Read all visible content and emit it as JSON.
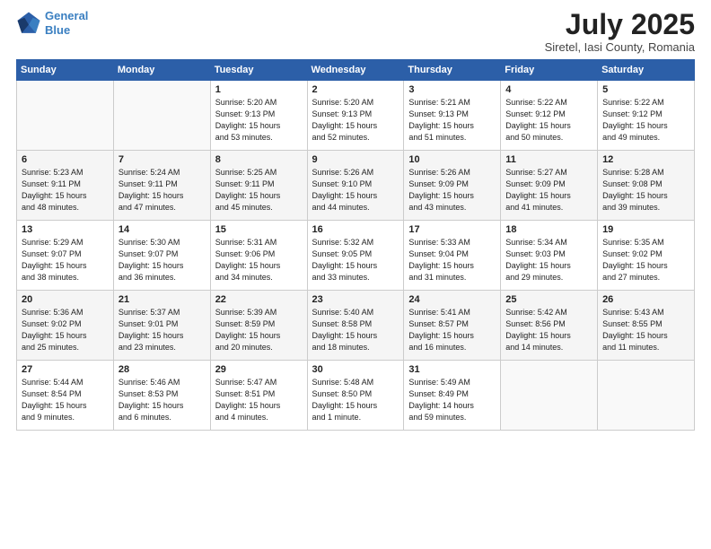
{
  "header": {
    "logo_line1": "General",
    "logo_line2": "Blue",
    "month": "July 2025",
    "location": "Siretel, Iasi County, Romania"
  },
  "weekdays": [
    "Sunday",
    "Monday",
    "Tuesday",
    "Wednesday",
    "Thursday",
    "Friday",
    "Saturday"
  ],
  "weeks": [
    [
      {
        "day": "",
        "info": ""
      },
      {
        "day": "",
        "info": ""
      },
      {
        "day": "1",
        "info": "Sunrise: 5:20 AM\nSunset: 9:13 PM\nDaylight: 15 hours\nand 53 minutes."
      },
      {
        "day": "2",
        "info": "Sunrise: 5:20 AM\nSunset: 9:13 PM\nDaylight: 15 hours\nand 52 minutes."
      },
      {
        "day": "3",
        "info": "Sunrise: 5:21 AM\nSunset: 9:13 PM\nDaylight: 15 hours\nand 51 minutes."
      },
      {
        "day": "4",
        "info": "Sunrise: 5:22 AM\nSunset: 9:12 PM\nDaylight: 15 hours\nand 50 minutes."
      },
      {
        "day": "5",
        "info": "Sunrise: 5:22 AM\nSunset: 9:12 PM\nDaylight: 15 hours\nand 49 minutes."
      }
    ],
    [
      {
        "day": "6",
        "info": "Sunrise: 5:23 AM\nSunset: 9:11 PM\nDaylight: 15 hours\nand 48 minutes."
      },
      {
        "day": "7",
        "info": "Sunrise: 5:24 AM\nSunset: 9:11 PM\nDaylight: 15 hours\nand 47 minutes."
      },
      {
        "day": "8",
        "info": "Sunrise: 5:25 AM\nSunset: 9:11 PM\nDaylight: 15 hours\nand 45 minutes."
      },
      {
        "day": "9",
        "info": "Sunrise: 5:26 AM\nSunset: 9:10 PM\nDaylight: 15 hours\nand 44 minutes."
      },
      {
        "day": "10",
        "info": "Sunrise: 5:26 AM\nSunset: 9:09 PM\nDaylight: 15 hours\nand 43 minutes."
      },
      {
        "day": "11",
        "info": "Sunrise: 5:27 AM\nSunset: 9:09 PM\nDaylight: 15 hours\nand 41 minutes."
      },
      {
        "day": "12",
        "info": "Sunrise: 5:28 AM\nSunset: 9:08 PM\nDaylight: 15 hours\nand 39 minutes."
      }
    ],
    [
      {
        "day": "13",
        "info": "Sunrise: 5:29 AM\nSunset: 9:07 PM\nDaylight: 15 hours\nand 38 minutes."
      },
      {
        "day": "14",
        "info": "Sunrise: 5:30 AM\nSunset: 9:07 PM\nDaylight: 15 hours\nand 36 minutes."
      },
      {
        "day": "15",
        "info": "Sunrise: 5:31 AM\nSunset: 9:06 PM\nDaylight: 15 hours\nand 34 minutes."
      },
      {
        "day": "16",
        "info": "Sunrise: 5:32 AM\nSunset: 9:05 PM\nDaylight: 15 hours\nand 33 minutes."
      },
      {
        "day": "17",
        "info": "Sunrise: 5:33 AM\nSunset: 9:04 PM\nDaylight: 15 hours\nand 31 minutes."
      },
      {
        "day": "18",
        "info": "Sunrise: 5:34 AM\nSunset: 9:03 PM\nDaylight: 15 hours\nand 29 minutes."
      },
      {
        "day": "19",
        "info": "Sunrise: 5:35 AM\nSunset: 9:02 PM\nDaylight: 15 hours\nand 27 minutes."
      }
    ],
    [
      {
        "day": "20",
        "info": "Sunrise: 5:36 AM\nSunset: 9:02 PM\nDaylight: 15 hours\nand 25 minutes."
      },
      {
        "day": "21",
        "info": "Sunrise: 5:37 AM\nSunset: 9:01 PM\nDaylight: 15 hours\nand 23 minutes."
      },
      {
        "day": "22",
        "info": "Sunrise: 5:39 AM\nSunset: 8:59 PM\nDaylight: 15 hours\nand 20 minutes."
      },
      {
        "day": "23",
        "info": "Sunrise: 5:40 AM\nSunset: 8:58 PM\nDaylight: 15 hours\nand 18 minutes."
      },
      {
        "day": "24",
        "info": "Sunrise: 5:41 AM\nSunset: 8:57 PM\nDaylight: 15 hours\nand 16 minutes."
      },
      {
        "day": "25",
        "info": "Sunrise: 5:42 AM\nSunset: 8:56 PM\nDaylight: 15 hours\nand 14 minutes."
      },
      {
        "day": "26",
        "info": "Sunrise: 5:43 AM\nSunset: 8:55 PM\nDaylight: 15 hours\nand 11 minutes."
      }
    ],
    [
      {
        "day": "27",
        "info": "Sunrise: 5:44 AM\nSunset: 8:54 PM\nDaylight: 15 hours\nand 9 minutes."
      },
      {
        "day": "28",
        "info": "Sunrise: 5:46 AM\nSunset: 8:53 PM\nDaylight: 15 hours\nand 6 minutes."
      },
      {
        "day": "29",
        "info": "Sunrise: 5:47 AM\nSunset: 8:51 PM\nDaylight: 15 hours\nand 4 minutes."
      },
      {
        "day": "30",
        "info": "Sunrise: 5:48 AM\nSunset: 8:50 PM\nDaylight: 15 hours\nand 1 minute."
      },
      {
        "day": "31",
        "info": "Sunrise: 5:49 AM\nSunset: 8:49 PM\nDaylight: 14 hours\nand 59 minutes."
      },
      {
        "day": "",
        "info": ""
      },
      {
        "day": "",
        "info": ""
      }
    ]
  ]
}
